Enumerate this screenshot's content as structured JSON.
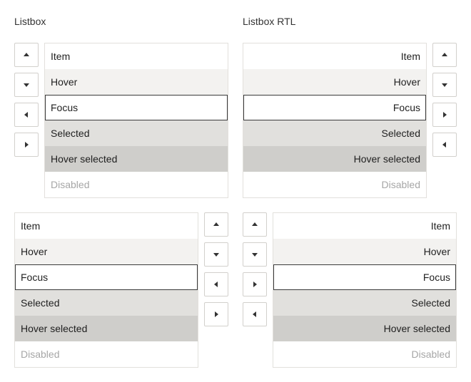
{
  "titles": {
    "listbox": "Listbox",
    "listbox_rtl": "Listbox RTL"
  },
  "options": [
    {
      "label": "Item",
      "state": "normal"
    },
    {
      "label": "Hover",
      "state": "hover"
    },
    {
      "label": "Focus",
      "state": "focus"
    },
    {
      "label": "Selected",
      "state": "selected"
    },
    {
      "label": "Hover selected",
      "state": "hover-selected"
    },
    {
      "label": "Disabled",
      "state": "disabled"
    }
  ],
  "icons": {
    "up": "triangle-up-icon",
    "down": "triangle-down-icon",
    "left": "triangle-left-icon",
    "right": "triangle-right-icon"
  },
  "colors": {
    "hover": "#f3f2f0",
    "selected": "#e1e0dd",
    "hover_selected": "#cfcecb",
    "focus_border": "#3a3a3a",
    "disabled_text": "#a6a6a6"
  }
}
